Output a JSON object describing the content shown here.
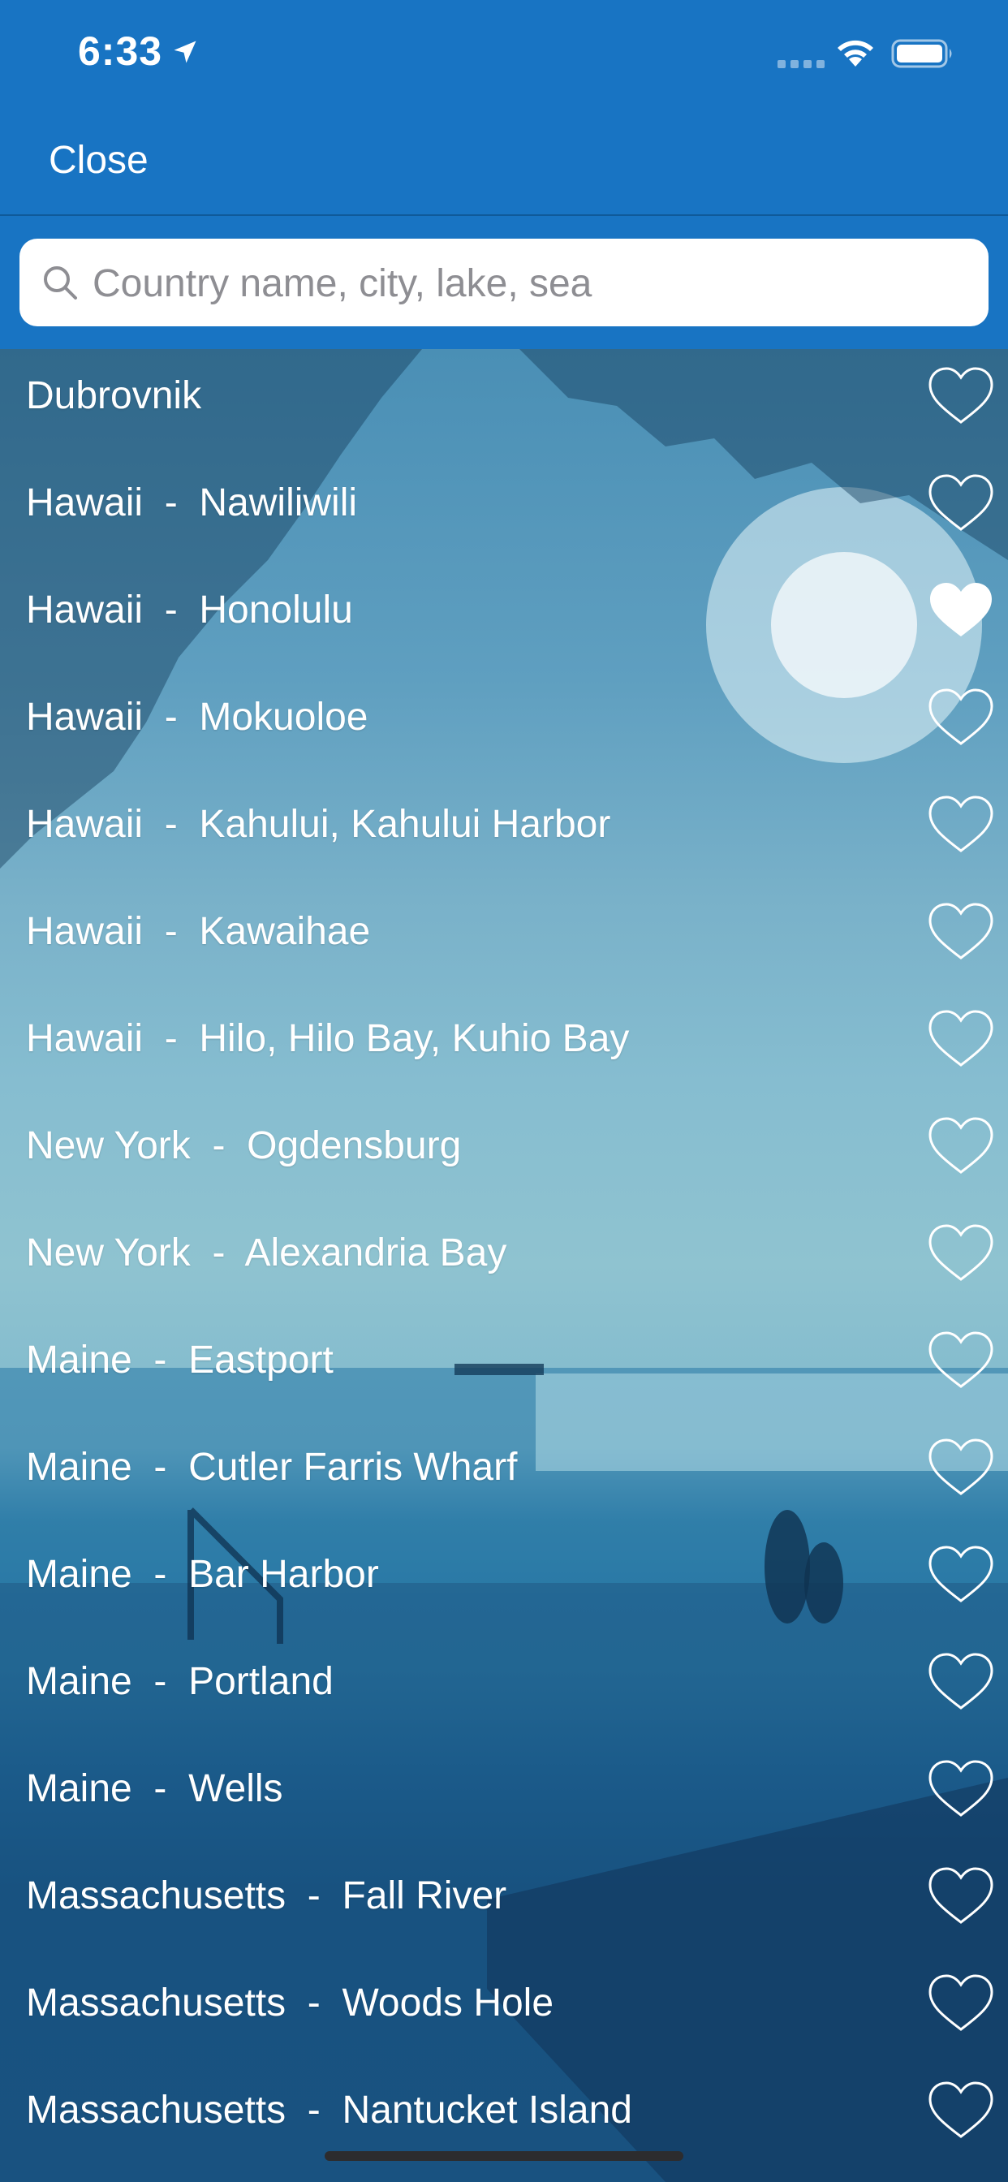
{
  "status": {
    "time": "6:33",
    "location_icon": "location-arrow-icon",
    "signal_icon": "cellular-signal-icon",
    "wifi_icon": "wifi-icon",
    "battery_icon": "battery-full-icon"
  },
  "nav": {
    "close_label": "Close"
  },
  "search": {
    "placeholder": "Country name, city, lake, sea",
    "value": "",
    "icon": "search-icon"
  },
  "colors": {
    "header": "#1874c3",
    "text": "#ffffff",
    "search_bg": "#ffffff"
  },
  "locations": [
    {
      "label": "Dubrovnik",
      "favorite": false
    },
    {
      "label": "Hawaii  -  Nawiliwili",
      "favorite": false
    },
    {
      "label": "Hawaii  -  Honolulu",
      "favorite": true
    },
    {
      "label": "Hawaii  -  Mokuoloe",
      "favorite": false
    },
    {
      "label": "Hawaii  -  Kahului, Kahului Harbor",
      "favorite": false
    },
    {
      "label": "Hawaii  -  Kawaihae",
      "favorite": false
    },
    {
      "label": "Hawaii  -  Hilo, Hilo Bay, Kuhio Bay",
      "favorite": false
    },
    {
      "label": "New York  -  Ogdensburg",
      "favorite": false
    },
    {
      "label": "New York  -  Alexandria Bay",
      "favorite": false
    },
    {
      "label": "Maine  -  Eastport",
      "favorite": false
    },
    {
      "label": "Maine  -  Cutler Farris Wharf",
      "favorite": false
    },
    {
      "label": "Maine  -  Bar Harbor",
      "favorite": false
    },
    {
      "label": "Maine  -  Portland",
      "favorite": false
    },
    {
      "label": "Maine  -  Wells",
      "favorite": false
    },
    {
      "label": "Massachusetts  -  Fall River",
      "favorite": false
    },
    {
      "label": "Massachusetts  -  Woods Hole",
      "favorite": false
    },
    {
      "label": "Massachusetts  -  Nantucket Island",
      "favorite": false
    }
  ]
}
